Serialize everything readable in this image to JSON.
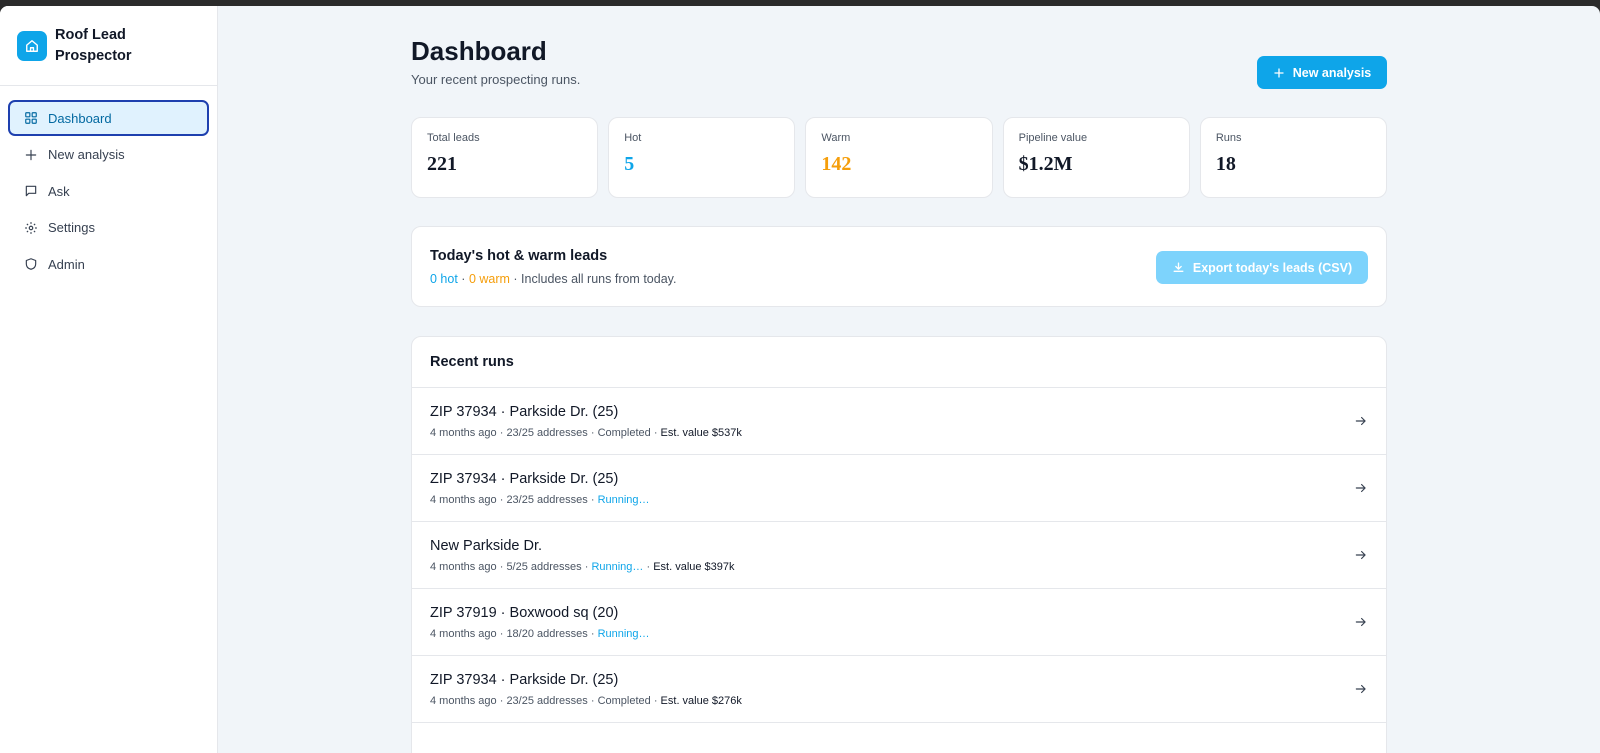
{
  "brand": {
    "name": "Roof Lead Prospector"
  },
  "nav": [
    {
      "label": "Dashboard",
      "icon": "dashboard-icon",
      "active": true
    },
    {
      "label": "New analysis",
      "icon": "plus-icon",
      "active": false
    },
    {
      "label": "Ask",
      "icon": "chat-icon",
      "active": false
    },
    {
      "label": "Settings",
      "icon": "gear-icon",
      "active": false
    },
    {
      "label": "Admin",
      "icon": "shield-icon",
      "active": false
    }
  ],
  "header": {
    "title": "Dashboard",
    "subtitle": "Your recent prospecting runs.",
    "new_analysis_label": "New analysis"
  },
  "stats": [
    {
      "label": "Total leads",
      "value": "221",
      "color": "#111827"
    },
    {
      "label": "Hot",
      "value": "5",
      "color": "#0ea5e9"
    },
    {
      "label": "Warm",
      "value": "142",
      "color": "#f59e0b"
    },
    {
      "label": "Pipeline value",
      "value": "$1.2M",
      "color": "#111827"
    },
    {
      "label": "Runs",
      "value": "18",
      "color": "#111827"
    }
  ],
  "today": {
    "title": "Today's hot & warm leads",
    "hot": "0 hot",
    "warm": "0 warm",
    "note": "Includes all runs from today.",
    "export_label": "Export today's leads (CSV)"
  },
  "runs": {
    "title": "Recent runs",
    "items": [
      {
        "title": "ZIP 37934 · Parkside Dr. (25)",
        "age": "4 months ago",
        "addresses": "23/25 addresses",
        "status": "Completed",
        "running": false,
        "est": "Est. value $537k"
      },
      {
        "title": "ZIP 37934 · Parkside Dr. (25)",
        "age": "4 months ago",
        "addresses": "23/25 addresses",
        "status": "Running…",
        "running": true,
        "est": ""
      },
      {
        "title": "New Parkside Dr.",
        "age": "4 months ago",
        "addresses": "5/25 addresses",
        "status": "Running…",
        "running": true,
        "est": "Est. value $397k"
      },
      {
        "title": "ZIP 37919 · Boxwood sq (20)",
        "age": "4 months ago",
        "addresses": "18/20 addresses",
        "status": "Running…",
        "running": true,
        "est": ""
      },
      {
        "title": "ZIP 37934 · Parkside Dr. (25)",
        "age": "4 months ago",
        "addresses": "23/25 addresses",
        "status": "Completed",
        "running": false,
        "est": "Est. value $276k"
      }
    ]
  },
  "colors": {
    "accent": "#0ea5e9",
    "warm": "#f59e0b",
    "background": "#f1f5f9"
  }
}
